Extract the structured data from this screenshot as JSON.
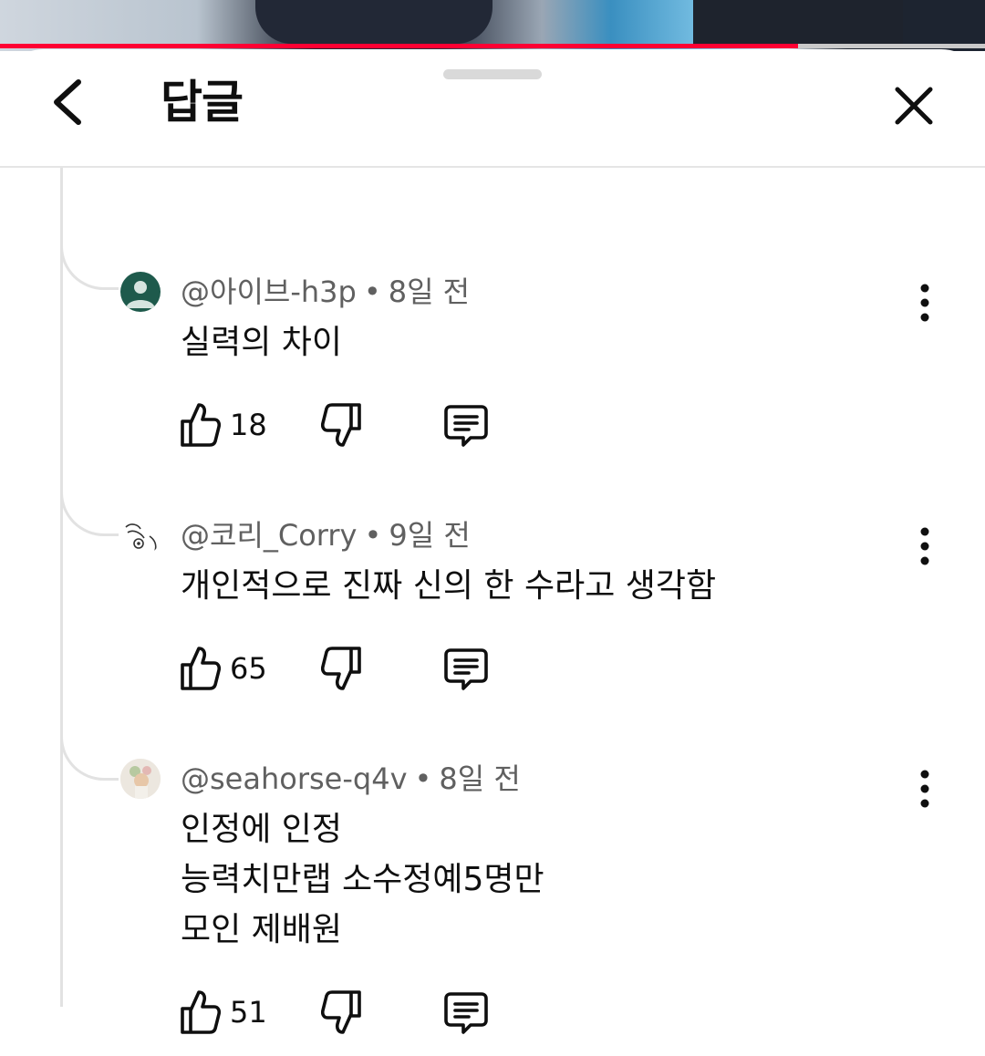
{
  "video": {
    "progress_fraction": 0.81
  },
  "sheet": {
    "title": "답글",
    "back_icon": "chevron-left-icon",
    "close_icon": "close-icon"
  },
  "replies": [
    {
      "author": "@아이브-h3p",
      "time": "8일 전",
      "text": "실력의 차이",
      "likes": "18",
      "avatar_color": "#1e5a4c"
    },
    {
      "author": "@코리_Corry",
      "time": "9일 전",
      "text": "개인적으로 진짜 신의 한 수라고 생각함",
      "likes": "65"
    },
    {
      "author": "@seahorse-q4v",
      "time": "8일 전",
      "text": "인정에 인정\n능력치만랩 소수정예5명만\n모인  제배원",
      "likes": "51"
    }
  ],
  "colors": {
    "progress": "#ff0033",
    "meta_text": "#606060",
    "primary_text": "#0f0f0f"
  }
}
